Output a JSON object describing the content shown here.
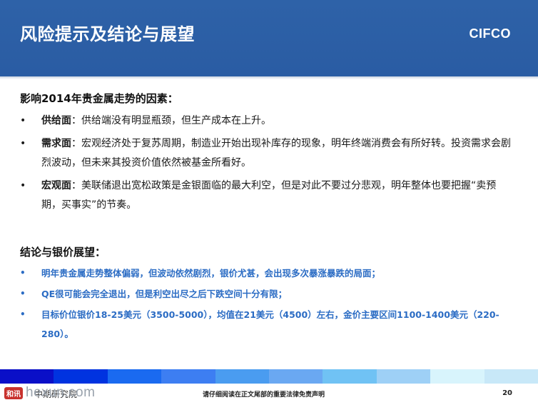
{
  "header": {
    "title": "风险提示及结论与展望",
    "brand": "CIFCO"
  },
  "factors": {
    "heading": "影响2014年贵金属走势的因素：",
    "items": [
      {
        "term": "供给面",
        "text": "：供给端没有明显瓶颈，但生产成本在上升。"
      },
      {
        "term": "需求面",
        "text": "：宏观经济处于复苏周期，制造业开始出现补库存的现象，明年终端消费会有所好转。投资需求会剧烈波动，但未来其投资价值依然被基金所看好。"
      },
      {
        "term": "宏观面",
        "text": "：美联储退出宽松政策是金银面临的最大利空，但是对此不要过分悲观，明年整体也要把握“卖预期，买事实”的节奏。"
      }
    ]
  },
  "outlook": {
    "heading": "结论与银价展望：",
    "items": [
      "明年贵金属走势整体偏弱，但波动依然剧烈，银价尤甚，会出现多次暴涨暴跌的局面；",
      "QE很可能会完全退出，但是利空出尽之后下跌空间十分有限；",
      "目标价位银价18-25美元（3500-5000），均值在21美元（4500）左右，金价主要区间1100-1400美元（220-280）。"
    ]
  },
  "footer": {
    "org": "中期研究院",
    "disclaimer": "请仔细阅读在正文尾部的重要法律免责声明",
    "page": "20",
    "band_colors": [
      "#0a0fc8",
      "#0033e0",
      "#1a6af0",
      "#3d7ef2",
      "#4a9cf0",
      "#6aa8f2",
      "#70c2f4",
      "#9ed0f6",
      "#d8f4fc",
      "#c8e8f8"
    ]
  },
  "watermark": {
    "badge": "和讯",
    "text": "hexun.com"
  }
}
